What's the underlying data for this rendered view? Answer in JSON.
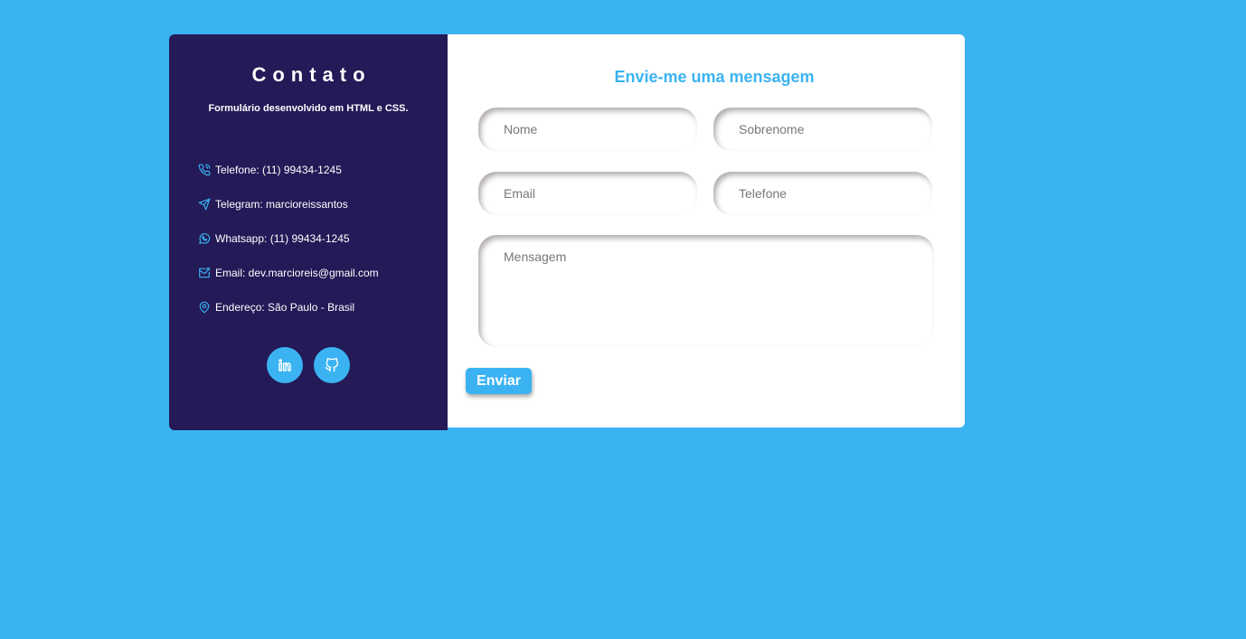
{
  "sidebar": {
    "title": "Contato",
    "subtitle": "Formulário desenvolvido em HTML e CSS.",
    "items": [
      {
        "icon": "phone-icon",
        "label": "Telefone: (11) 99434-1245"
      },
      {
        "icon": "telegram-icon",
        "label": "Telegram: marcioreissantos"
      },
      {
        "icon": "whatsapp-icon",
        "label": "Whatsapp: (11) 99434-1245"
      },
      {
        "icon": "mail-icon",
        "label": "Email: dev.marcioreis@gmail.com"
      },
      {
        "icon": "location-pin-icon",
        "label": "Endereço: São Paulo - Brasil"
      }
    ],
    "social": [
      {
        "icon": "linkedin-icon"
      },
      {
        "icon": "github-icon"
      }
    ]
  },
  "form": {
    "title": "Envie-me uma mensagem",
    "fields": {
      "nome": {
        "placeholder": "Nome",
        "value": ""
      },
      "sobrenome": {
        "placeholder": "Sobrenome",
        "value": ""
      },
      "email": {
        "placeholder": "Email",
        "value": ""
      },
      "telefone": {
        "placeholder": "Telefone",
        "value": ""
      },
      "mensagem": {
        "placeholder": "Mensagem",
        "value": ""
      }
    },
    "submit_label": "Enviar"
  },
  "colors": {
    "background": "#3bb3f2",
    "sidebar": "#231a57",
    "accent": "#3bb3f2",
    "panel": "#ffffff"
  }
}
